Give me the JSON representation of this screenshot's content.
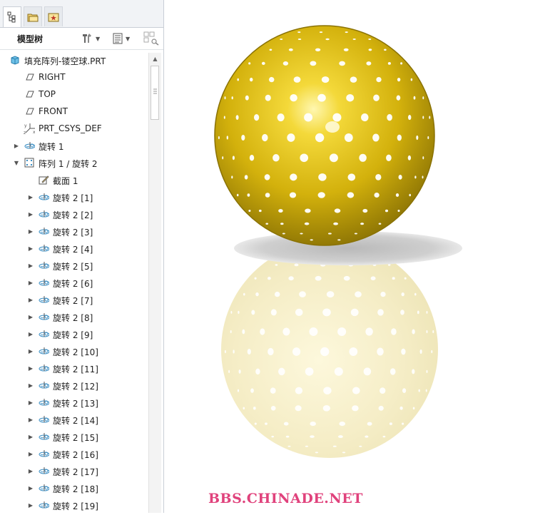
{
  "tabs": [
    {
      "icon": "model-tree-tab-icon"
    },
    {
      "icon": "folder-browser-tab-icon"
    },
    {
      "icon": "favorites-tab-icon"
    }
  ],
  "toolbar": {
    "title": "模型树",
    "settings_icon": "tools-icon",
    "show_icon": "tree-list-icon",
    "filter_icon": "tree-filter-icon"
  },
  "tree": {
    "items": [
      {
        "label": "填充阵列-镂空球.PRT",
        "icon": "part-icon",
        "level": 0,
        "expander": "none"
      },
      {
        "label": "RIGHT",
        "icon": "datum-plane-icon",
        "level": 1,
        "expander": "none"
      },
      {
        "label": "TOP",
        "icon": "datum-plane-icon",
        "level": 1,
        "expander": "none"
      },
      {
        "label": "FRONT",
        "icon": "datum-plane-icon",
        "level": 1,
        "expander": "none"
      },
      {
        "label": "PRT_CSYS_DEF",
        "icon": "coordinate-system-icon",
        "level": 1,
        "expander": "none"
      },
      {
        "label": "旋转 1",
        "icon": "revolve-icon",
        "level": 1,
        "expander": "collapsed"
      },
      {
        "label": "阵列 1 / 旋转 2",
        "icon": "pattern-icon",
        "level": 1,
        "expander": "expanded"
      },
      {
        "label": "截面 1",
        "icon": "sketch-icon",
        "level": 2,
        "expander": "none"
      },
      {
        "label": "旋转 2 [1]",
        "icon": "revolve-icon",
        "level": 2,
        "expander": "collapsed"
      },
      {
        "label": "旋转 2 [2]",
        "icon": "revolve-icon",
        "level": 2,
        "expander": "collapsed"
      },
      {
        "label": "旋转 2 [3]",
        "icon": "revolve-icon",
        "level": 2,
        "expander": "collapsed"
      },
      {
        "label": "旋转 2 [4]",
        "icon": "revolve-icon",
        "level": 2,
        "expander": "collapsed"
      },
      {
        "label": "旋转 2 [5]",
        "icon": "revolve-icon",
        "level": 2,
        "expander": "collapsed"
      },
      {
        "label": "旋转 2 [6]",
        "icon": "revolve-icon",
        "level": 2,
        "expander": "collapsed"
      },
      {
        "label": "旋转 2 [7]",
        "icon": "revolve-icon",
        "level": 2,
        "expander": "collapsed"
      },
      {
        "label": "旋转 2 [8]",
        "icon": "revolve-icon",
        "level": 2,
        "expander": "collapsed"
      },
      {
        "label": "旋转 2 [9]",
        "icon": "revolve-icon",
        "level": 2,
        "expander": "collapsed"
      },
      {
        "label": "旋转 2 [10]",
        "icon": "revolve-icon",
        "level": 2,
        "expander": "collapsed"
      },
      {
        "label": "旋转 2 [11]",
        "icon": "revolve-icon",
        "level": 2,
        "expander": "collapsed"
      },
      {
        "label": "旋转 2 [12]",
        "icon": "revolve-icon",
        "level": 2,
        "expander": "collapsed"
      },
      {
        "label": "旋转 2 [13]",
        "icon": "revolve-icon",
        "level": 2,
        "expander": "collapsed"
      },
      {
        "label": "旋转 2 [14]",
        "icon": "revolve-icon",
        "level": 2,
        "expander": "collapsed"
      },
      {
        "label": "旋转 2 [15]",
        "icon": "revolve-icon",
        "level": 2,
        "expander": "collapsed"
      },
      {
        "label": "旋转 2 [16]",
        "icon": "revolve-icon",
        "level": 2,
        "expander": "collapsed"
      },
      {
        "label": "旋转 2 [17]",
        "icon": "revolve-icon",
        "level": 2,
        "expander": "collapsed"
      },
      {
        "label": "旋转 2 [18]",
        "icon": "revolve-icon",
        "level": 2,
        "expander": "collapsed"
      },
      {
        "label": "旋转 2 [19]",
        "icon": "revolve-icon",
        "level": 2,
        "expander": "collapsed"
      }
    ]
  },
  "viewport": {
    "model": "perforated-sphere",
    "model_color": "#d7b90f",
    "reflection_color": "#f3ecc4",
    "shadow_color": "#c8c8c8"
  },
  "watermark": "BBS.CHINADE.NET",
  "colors": {
    "watermark": "#e0427c",
    "panel_border": "#c9ced6"
  }
}
